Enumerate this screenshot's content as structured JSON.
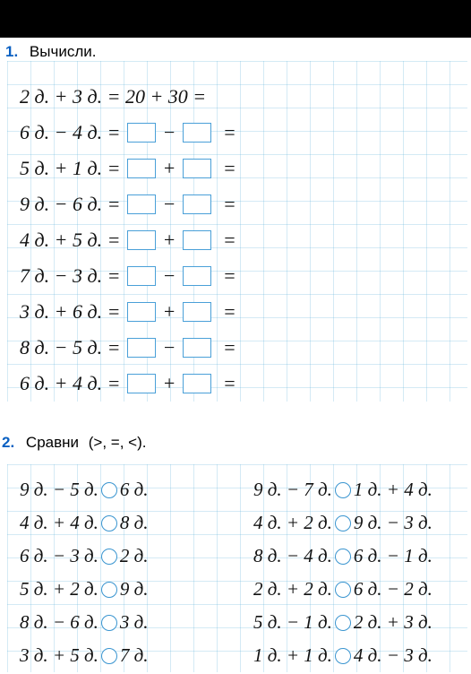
{
  "task1": {
    "number": "1.",
    "title": "Вычисли.",
    "rows": [
      {
        "a": "2",
        "op": "+",
        "b": "3",
        "type": "filled",
        "va": "20",
        "vb": "30"
      },
      {
        "a": "6",
        "op": "−",
        "b": "4",
        "type": "boxes"
      },
      {
        "a": "5",
        "op": "+",
        "b": "1",
        "type": "boxes"
      },
      {
        "a": "9",
        "op": "−",
        "b": "6",
        "type": "boxes"
      },
      {
        "a": "4",
        "op": "+",
        "b": "5",
        "type": "boxes"
      },
      {
        "a": "7",
        "op": "−",
        "b": "3",
        "type": "boxes"
      },
      {
        "a": "3",
        "op": "+",
        "b": "6",
        "type": "boxes"
      },
      {
        "a": "8",
        "op": "−",
        "b": "5",
        "type": "boxes"
      },
      {
        "a": "6",
        "op": "+",
        "b": "4",
        "type": "boxes"
      }
    ]
  },
  "task2": {
    "number": "2.",
    "title": "Сравни",
    "hint": "(>,  =,  <).",
    "left": [
      {
        "l": "9 д. − 5 д.",
        "r": "6 д."
      },
      {
        "l": "4 д. + 4 д.",
        "r": "8 д."
      },
      {
        "l": "6 д. − 3 д.",
        "r": "2 д."
      },
      {
        "l": "5 д. + 2 д.",
        "r": "9 д."
      },
      {
        "l": "8 д. − 6 д.",
        "r": "3 д."
      },
      {
        "l": "3 д. + 5 д.",
        "r": "7 д."
      }
    ],
    "right": [
      {
        "l": "9 д. − 7 д.",
        "r": "1 д. + 4 д."
      },
      {
        "l": "4 д. + 2 д.",
        "r": "9 д. − 3 д."
      },
      {
        "l": "8 д. − 4 д.",
        "r": "6 д. − 1 д."
      },
      {
        "l": "2 д. + 2 д.",
        "r": "6 д. − 2 д."
      },
      {
        "l": "5 д. − 1 д.",
        "r": "2 д. + 3 д."
      },
      {
        "l": "1 д. + 1 д.",
        "r": "4 д. − 3 д."
      }
    ]
  },
  "unit": "д."
}
